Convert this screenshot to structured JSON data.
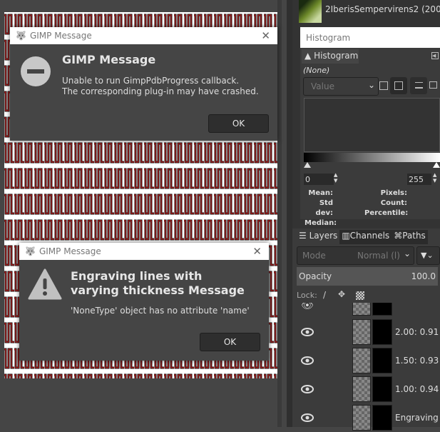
{
  "dialogs": [
    {
      "window_title": "GIMP Message",
      "title": "GIMP Message",
      "message_lines": [
        "Unable to run GimpPdbProgress callback.",
        "The corresponding plug-in may have crashed."
      ],
      "ok_label": "OK",
      "icon": "error-minus-icon"
    },
    {
      "window_title": "GIMP Message",
      "title_lines": [
        "Engraving lines with",
        "varying thickness Message"
      ],
      "message_lines": [
        "'NoneType' object has no attribute 'name'"
      ],
      "ok_label": "OK",
      "icon": "warning-icon"
    }
  ],
  "image_list": {
    "name": "2IberisSempervirens2 (200"
  },
  "histogram": {
    "window_title": "Histogram",
    "tab_label": "Histogram",
    "drawable": "(None)",
    "channel": "Value",
    "range_min": "0",
    "range_max": "255",
    "stats_left": [
      "Mean:",
      "Std dev:",
      "Median:"
    ],
    "stats_right": [
      "Pixels:",
      "Count:",
      "Percentile:"
    ]
  },
  "layers": {
    "tabs": [
      "Layers",
      "Channels",
      "Paths"
    ],
    "mode_label": "Mode",
    "mode_value": "Normal (l)",
    "opacity_label": "Opacity",
    "opacity_value": "100.0",
    "lock_label": "Lock:",
    "items": [
      "",
      "2.00: 0.91",
      "1.50: 0.93",
      "1.00: 0.94",
      "Engraving"
    ]
  },
  "colors": {
    "accent_red": "#e02020",
    "bg": "#454545"
  }
}
